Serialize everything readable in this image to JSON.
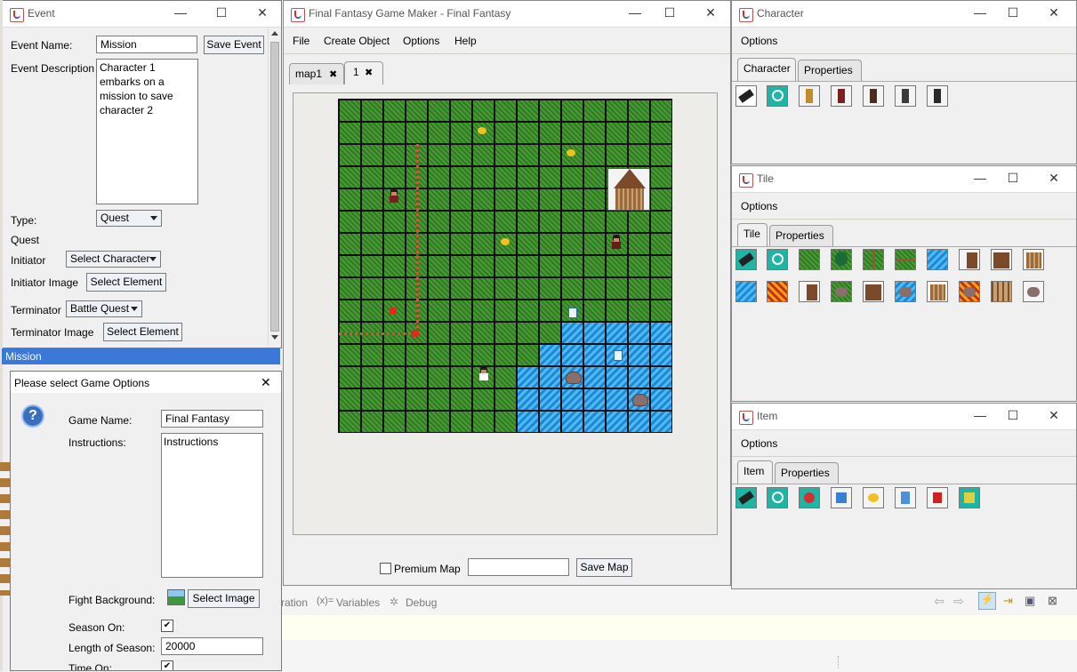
{
  "event_window": {
    "title": "Event",
    "name_label": "Event Name:",
    "name_value": "Mission",
    "save_label": "Save Event",
    "desc_label": "Event Description",
    "desc_value": "Character 1 embarks on a mission to save character 2",
    "type_label": "Type:",
    "type_value": "Quest",
    "quest_label": "Quest",
    "initiator_label": "Initiator",
    "initiator_value": "Select Character",
    "initiator_image_label": "Initiator Image",
    "select_element_label": "Select Element",
    "terminator_label": "Terminator",
    "terminator_value": "Battle Quest",
    "terminator_image_label": "Terminator Image",
    "list_selected": "Mission"
  },
  "game_options": {
    "title": "Please select Game Options",
    "game_name_label": "Game Name:",
    "game_name_value": "Final Fantasy",
    "instructions_label": "Instructions:",
    "instructions_value": "Instructions",
    "fight_bg_label": "Fight Background:",
    "select_image_label": "Select Image",
    "season_on_label": "Season On:",
    "season_on_checked": true,
    "length_label": "Length of Season:",
    "length_value": "20000",
    "time_on_label": "Time On:",
    "time_on_checked": true
  },
  "main_window": {
    "title": "Final Fantasy Game Maker - Final Fantasy",
    "menu": [
      "File",
      "Create Object",
      "Options",
      "Help"
    ],
    "tabs": [
      {
        "label": "map1"
      },
      {
        "label": "1"
      }
    ],
    "premium_label": "Premium Map",
    "premium_checked": false,
    "map_name_value": "",
    "save_map_label": "Save Map"
  },
  "character_window": {
    "title": "Character",
    "options_label": "Options",
    "tabs": [
      "Character",
      "Properties"
    ]
  },
  "tile_window": {
    "title": "Tile",
    "options_label": "Options",
    "tabs": [
      "Tile",
      "Properties"
    ]
  },
  "item_window": {
    "title": "Item",
    "options_label": "Options",
    "tabs": [
      "Item",
      "Properties"
    ]
  },
  "background_ide": {
    "tab_partial": "ration",
    "variables_label": "Variables",
    "debug_label": "Debug"
  },
  "icons": {
    "minimize": "—",
    "maximize": "☐",
    "close": "✕",
    "tab_close": "✖",
    "check": "✔"
  }
}
